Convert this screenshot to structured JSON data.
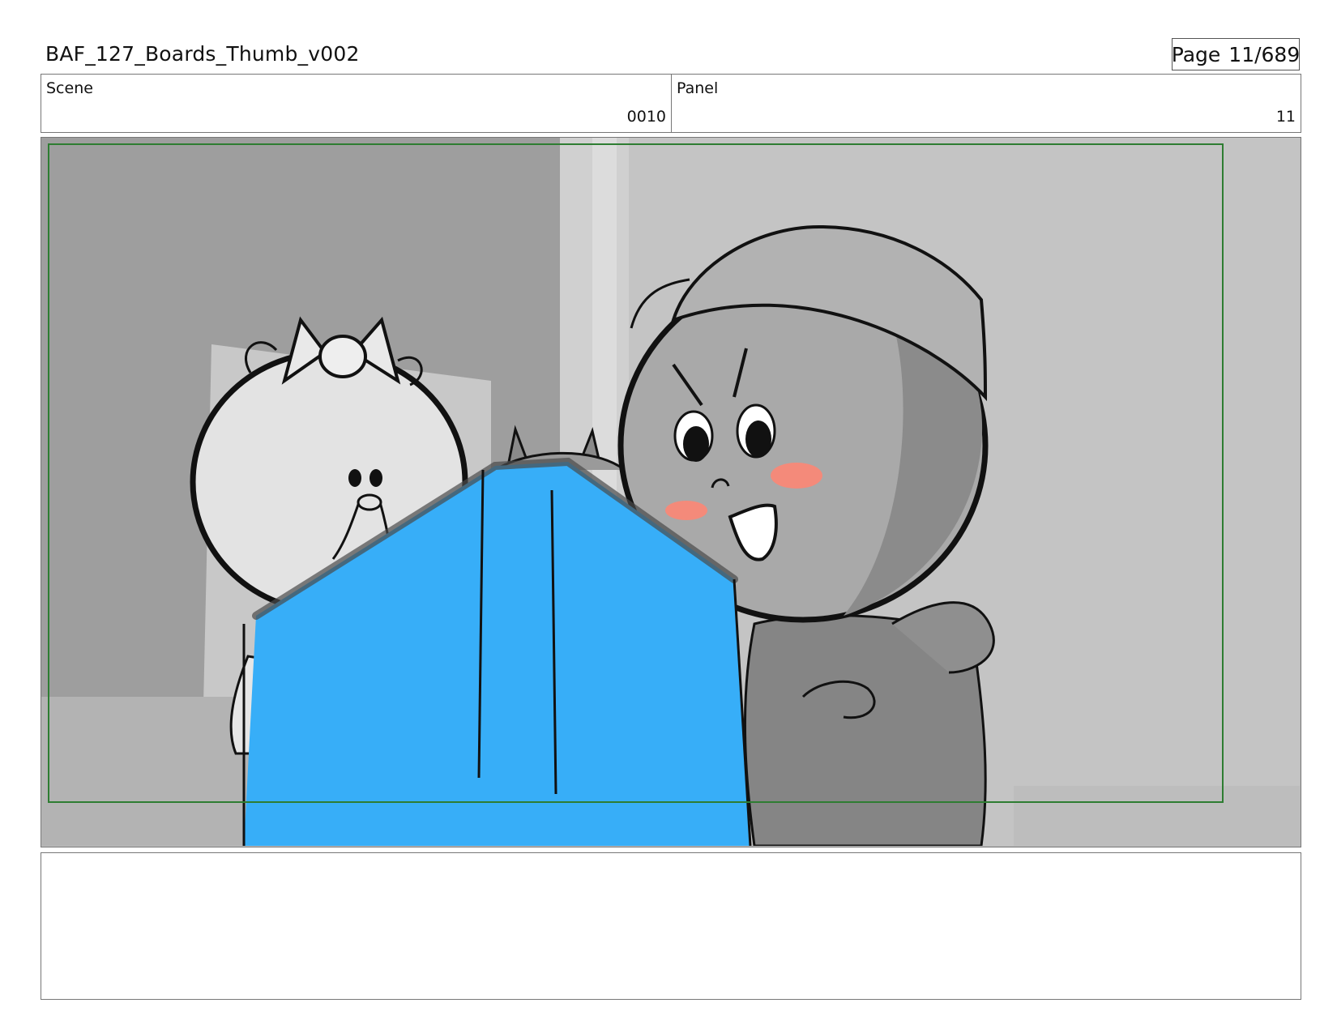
{
  "header": {
    "title": "BAF_127_Boards_Thumb_v002",
    "page_label": "Page",
    "page_value": "11/689"
  },
  "info": {
    "scene_label": "Scene",
    "scene_value": "0010",
    "panel_label": "Panel",
    "panel_value": "11"
  },
  "frame": {
    "safe_area_color": "#2e7d32",
    "object_color": "#37aef8",
    "blush_color": "#f48a7a"
  },
  "notes": {
    "text": ""
  }
}
